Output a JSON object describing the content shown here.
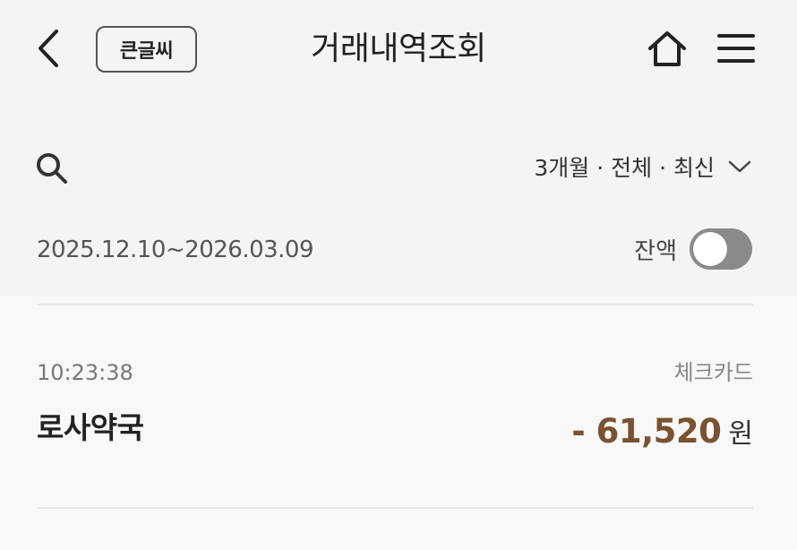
{
  "header": {
    "big_font_label": "큰글씨",
    "title": "거래내역조회"
  },
  "filter": {
    "label": "3개월 · 전체 · 최신",
    "date_range": "2025.12.10~2026.03.09",
    "balance_label": "잔액",
    "balance_toggle_on": false
  },
  "transactions": [
    {
      "time": "10:23:38",
      "type": "체크카드",
      "merchant": "로사약국",
      "amount": "- 61,520",
      "unit": "원"
    }
  ],
  "colors": {
    "background": "#f4f4f4",
    "amount": "#7a5230",
    "toggle_off": "#8a8a8a"
  },
  "icons": [
    "back-arrow-icon",
    "home-icon",
    "hamburger-menu-icon",
    "search-icon",
    "chevron-down-icon"
  ]
}
